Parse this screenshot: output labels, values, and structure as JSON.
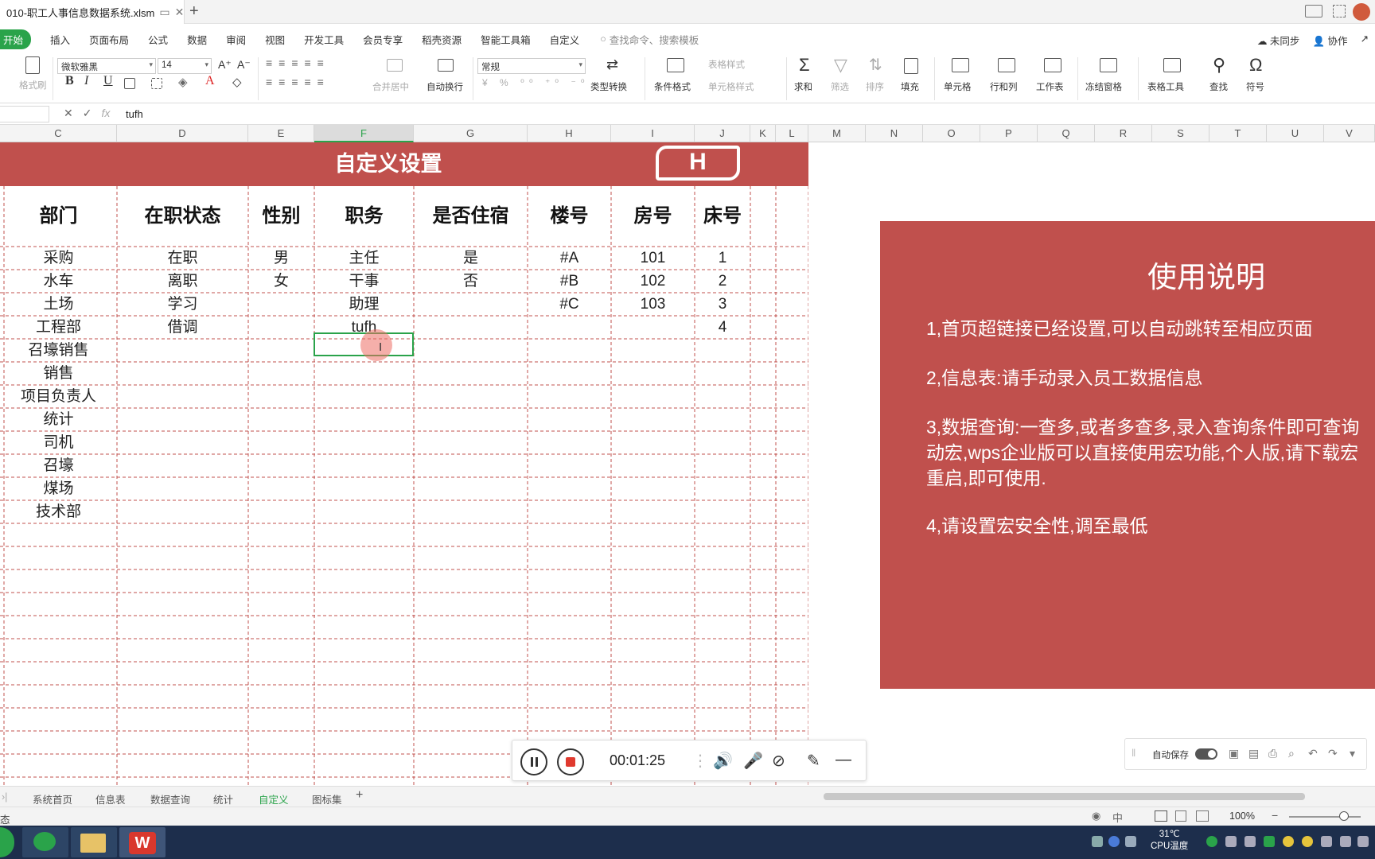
{
  "window": {
    "doc_title": "010-职工人事信息数据系统.xlsm"
  },
  "menu": {
    "start": "开始",
    "items": [
      "插入",
      "页面布局",
      "公式",
      "数据",
      "审阅",
      "视图",
      "开发工具",
      "会员专享",
      "稻壳资源",
      "智能工具箱",
      "自定义"
    ],
    "search_placeholder": "查找命令、搜索模板",
    "sync": "未同步",
    "collab": "协作"
  },
  "ribbon": {
    "format_painter": "格式刷",
    "font_name": "微软雅黑",
    "font_size": "14",
    "merge_center": "合并居中",
    "wrap_text": "自动换行",
    "number_format": "常规",
    "type_convert": "类型转换",
    "conditional_format": "条件格式",
    "table_style": "表格样式",
    "cell_style": "单元格样式",
    "sum": "求和",
    "filter": "筛选",
    "sort": "排序",
    "fill": "填充",
    "cell": "单元格",
    "row_col": "行和列",
    "worksheet": "工作表",
    "freeze": "冻结窗格",
    "table_tools": "表格工具",
    "find": "查找",
    "symbol": "符号"
  },
  "formula_bar": {
    "content": "tufh"
  },
  "columns": [
    "C",
    "D",
    "E",
    "F",
    "G",
    "H",
    "I",
    "J",
    "K",
    "L",
    "M",
    "N",
    "O",
    "P",
    "Q",
    "R",
    "S",
    "T",
    "U",
    "V"
  ],
  "active_column": "F",
  "sheet": {
    "banner_title": "自定义设置",
    "home_button": "H",
    "headers": [
      "部门",
      "在职状态",
      "性别",
      "职务",
      "是否住宿",
      "楼号",
      "房号",
      "床号"
    ],
    "rows": [
      [
        "采购",
        "在职",
        "男",
        "主任",
        "是",
        "#A",
        "101",
        "1"
      ],
      [
        "水车",
        "离职",
        "女",
        "干事",
        "否",
        "#B",
        "102",
        "2"
      ],
      [
        "土场",
        "学习",
        "",
        "助理",
        "",
        "#C",
        "103",
        "3"
      ],
      [
        "工程部",
        "借调",
        "",
        "tufh",
        "",
        "",
        "",
        "4"
      ],
      [
        "召壕销售",
        "",
        "",
        "",
        "",
        "",
        "",
        ""
      ],
      [
        "销售",
        "",
        "",
        "",
        "",
        "",
        "",
        ""
      ],
      [
        "项目负责人",
        "",
        "",
        "",
        "",
        "",
        "",
        ""
      ],
      [
        "统计",
        "",
        "",
        "",
        "",
        "",
        "",
        ""
      ],
      [
        "司机",
        "",
        "",
        "",
        "",
        "",
        "",
        ""
      ],
      [
        "召壕",
        "",
        "",
        "",
        "",
        "",
        "",
        ""
      ],
      [
        "煤场",
        "",
        "",
        "",
        "",
        "",
        "",
        ""
      ],
      [
        "技术部",
        "",
        "",
        "",
        "",
        "",
        "",
        ""
      ]
    ]
  },
  "usage": {
    "title": "使用说明",
    "lines": [
      "1,首页超链接已经设置,可以自动跳转至相应页面",
      "2,信息表:请手动录入员工数据信息",
      "3,数据查询:一查多,或者多查多,录入查询条件即可查询",
      "动宏,wps企业版可以直接使用宏功能,个人版,请下载宏",
      "重启,即可使用.",
      "4,请设置宏安全性,调至最低"
    ]
  },
  "recorder": {
    "time": "00:01:25"
  },
  "autosave": {
    "label": "自动保存"
  },
  "sheet_tabs": [
    "系统首页",
    "信息表",
    "数据查询",
    "统计",
    "自定义",
    "图标集"
  ],
  "active_sheet": "自定义",
  "status": {
    "left": "态",
    "zoom": "100%"
  },
  "taskbar": {
    "temperature": "31℃",
    "cpu_label": "CPU温度"
  }
}
